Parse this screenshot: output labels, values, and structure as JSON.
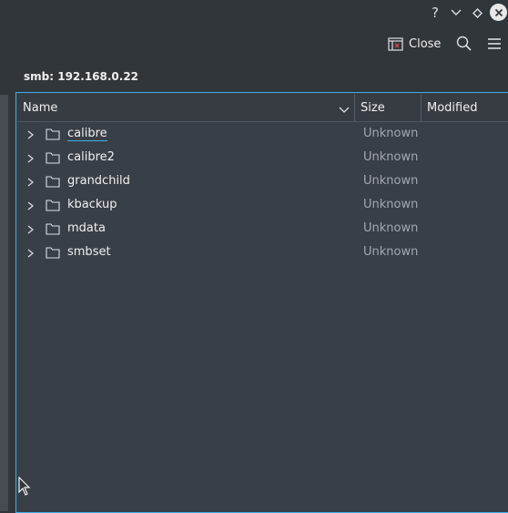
{
  "titlebar": {
    "buttons": [
      "help-icon",
      "minimize-icon",
      "keep-above-icon",
      "close-window-icon"
    ],
    "help_glyph": "?"
  },
  "toolbar": {
    "close_label": "Close",
    "icons": [
      "close-panel-icon",
      "search-icon",
      "hamburger-menu-icon"
    ]
  },
  "location": {
    "label": "smb: 192.168.0.22"
  },
  "table": {
    "columns": [
      "Name",
      "Size",
      "Modified"
    ],
    "rows": [
      {
        "name": "calibre",
        "size": "Unknown",
        "modified": ""
      },
      {
        "name": "calibre2",
        "size": "Unknown",
        "modified": ""
      },
      {
        "name": "grandchild",
        "size": "Unknown",
        "modified": ""
      },
      {
        "name": "kbackup",
        "size": "Unknown",
        "modified": ""
      },
      {
        "name": "mdata",
        "size": "Unknown",
        "modified": ""
      },
      {
        "name": "smbset",
        "size": "Unknown",
        "modified": ""
      }
    ]
  },
  "colors": {
    "background": "#31363b",
    "view_background": "#393f46",
    "accent": "#3daee9",
    "text": "#eff0f1",
    "muted_text": "#a4a9ae"
  }
}
